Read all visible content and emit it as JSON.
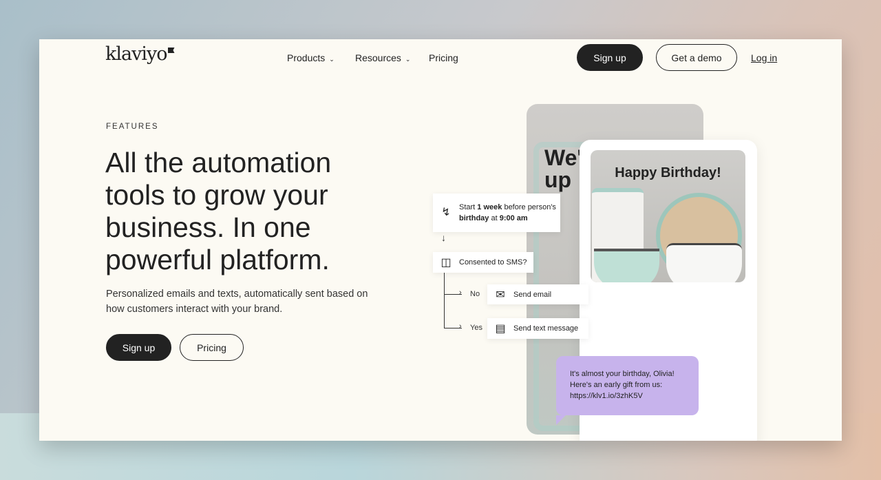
{
  "header": {
    "logo": "klaviyo",
    "nav": [
      {
        "label": "Products"
      },
      {
        "label": "Resources"
      },
      {
        "label": "Pricing"
      }
    ],
    "signup": "Sign up",
    "demo": "Get a demo",
    "login": "Log in"
  },
  "hero": {
    "eyebrow": "FEATURES",
    "title": "All the automation tools to grow your business. In one powerful platform.",
    "subtitle": "Personalized emails and texts, automatically sent based on how customers interact with your brand.",
    "signup": "Sign up",
    "pricing": "Pricing"
  },
  "visual": {
    "back_headline": "We'\nup\ns",
    "photo_title": "Happy Birthday!",
    "trigger": {
      "pre": "Start ",
      "bold1": "1 week",
      "mid": " before person's",
      "bold2": "birthday",
      "mid2": " at ",
      "bold3": "9:00 am"
    },
    "condition": "Consented to SMS?",
    "no": "No",
    "yes": "Yes",
    "send_email": "Send email",
    "send_text": "Send text message",
    "sms": [
      "It's almost your birthday, Olivia!",
      "Here's an early gift from us:",
      "https://klv1.io/3zhK5V"
    ],
    "sms_color": "#c7b3ec"
  }
}
